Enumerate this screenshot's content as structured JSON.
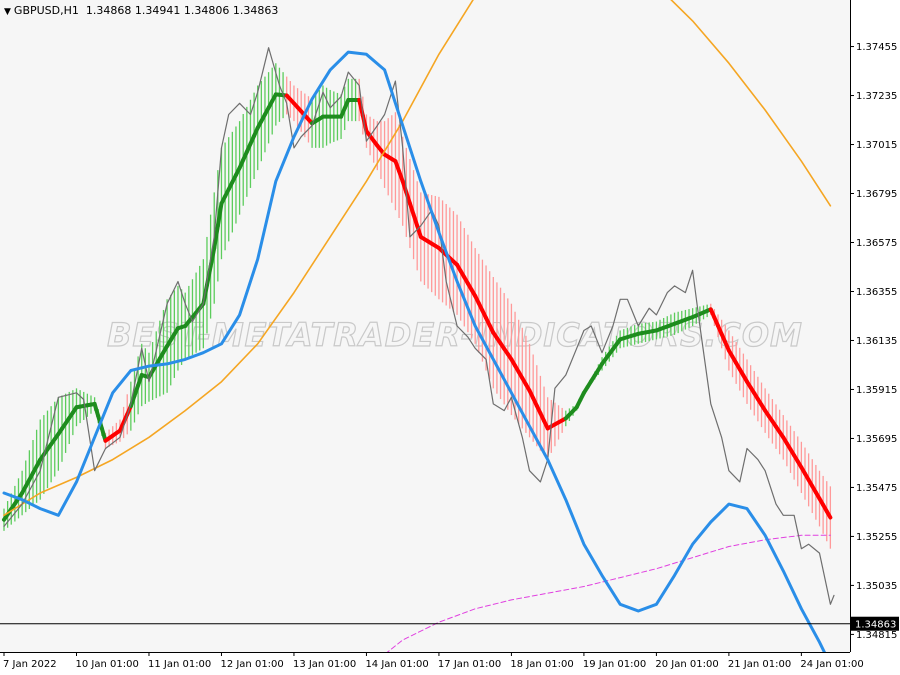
{
  "header": {
    "symbol": "GBPUSD,H1",
    "ohlc": "1.34868 1.34941 1.34806 1.34863",
    "arrow": "▼"
  },
  "watermark": "BEST-METATRADER-INDICATORS.COM",
  "colors": {
    "background": "#f6f6f6",
    "axis_background": "#ffffff",
    "bull": "#1e8c1e",
    "bull_light": "#5ccc5c",
    "bear": "#ff0000",
    "bear_light": "#ff9999",
    "fast_ma": "#2a8ee8",
    "slow_ma": "#f5a623",
    "long_ma": "#e040e0",
    "price_line": "#6e6e6e",
    "bid_line": "#000000"
  },
  "chart_data": {
    "type": "line",
    "ylim": [
      1.34736,
      1.37664
    ],
    "y_ticks": [
      "1.37455",
      "1.37235",
      "1.37015",
      "1.36795",
      "1.36575",
      "1.36355",
      "1.36135",
      "1.35915",
      "1.35695",
      "1.35475",
      "1.35255",
      "1.35035",
      "1.34815"
    ],
    "y_tick_values": [
      1.37455,
      1.37235,
      1.37015,
      1.36795,
      1.36575,
      1.36355,
      1.36135,
      1.35915,
      1.35695,
      1.35475,
      1.35255,
      1.35035,
      1.34815
    ],
    "x_ticks": [
      "7 Jan 2022",
      "10 Jan 01:00",
      "11 Jan 01:00",
      "12 Jan 01:00",
      "13 Jan 01:00",
      "14 Jan 01:00",
      "17 Jan 01:00",
      "18 Jan 01:00",
      "19 Jan 01:00",
      "20 Jan 01:00",
      "21 Jan 01:00",
      "24 Jan 01:00"
    ],
    "x_tick_index": [
      0,
      20,
      40,
      60,
      80,
      100,
      120,
      140,
      160,
      180,
      200,
      220
    ],
    "current_price": "1.34863",
    "current_price_value": 1.34863,
    "series": [
      {
        "role": "price",
        "x": [
          0,
          5,
          10,
          15,
          20,
          22,
          25,
          28,
          32,
          35,
          38,
          40,
          45,
          48,
          50,
          52,
          55,
          58,
          60,
          62,
          65,
          68,
          70,
          73,
          76,
          78,
          80,
          82,
          85,
          88,
          90,
          93,
          95,
          98,
          100,
          103,
          105,
          108,
          110,
          112,
          115,
          118,
          120,
          122,
          125,
          128,
          130,
          133,
          135,
          138,
          140,
          143,
          145,
          148,
          150,
          152,
          155,
          158,
          160,
          162,
          165,
          168,
          170,
          172,
          175,
          178,
          180,
          183,
          185,
          188,
          190,
          192,
          195,
          198,
          200,
          203,
          205,
          208,
          210,
          213,
          215,
          218,
          220,
          222,
          225,
          228,
          229
        ],
        "y": [
          1.353,
          1.354,
          1.3555,
          1.3588,
          1.359,
          1.3587,
          1.3555,
          1.3565,
          1.357,
          1.3585,
          1.361,
          1.3595,
          1.363,
          1.364,
          1.363,
          1.3622,
          1.363,
          1.366,
          1.37,
          1.3715,
          1.372,
          1.3715,
          1.3725,
          1.3745,
          1.3728,
          1.372,
          1.37,
          1.3705,
          1.371,
          1.3725,
          1.3718,
          1.3723,
          1.3734,
          1.3728,
          1.3703,
          1.371,
          1.3715,
          1.373,
          1.37,
          1.366,
          1.3665,
          1.3672,
          1.3665,
          1.364,
          1.362,
          1.3615,
          1.361,
          1.3605,
          1.3585,
          1.3582,
          1.3588,
          1.357,
          1.3555,
          1.355,
          1.356,
          1.3592,
          1.3598,
          1.361,
          1.3618,
          1.362,
          1.3608,
          1.362,
          1.3632,
          1.3632,
          1.362,
          1.3628,
          1.3625,
          1.3635,
          1.3638,
          1.3635,
          1.3645,
          1.362,
          1.3585,
          1.357,
          1.3555,
          1.355,
          1.3565,
          1.356,
          1.3555,
          1.354,
          1.3535,
          1.3535,
          1.352,
          1.3522,
          1.3518,
          1.3495,
          1.3499
        ]
      },
      {
        "role": "fast_ma",
        "x": [
          0,
          5,
          10,
          15,
          20,
          25,
          30,
          35,
          40,
          45,
          50,
          55,
          60,
          65,
          70,
          75,
          80,
          85,
          90,
          95,
          100,
          105,
          110,
          115,
          120,
          125,
          130,
          135,
          140,
          145,
          150,
          155,
          160,
          165,
          170,
          175,
          180,
          185,
          190,
          195,
          200,
          205,
          210,
          215,
          220,
          225,
          228
        ],
        "y": [
          1.3545,
          1.3542,
          1.3538,
          1.3535,
          1.355,
          1.357,
          1.359,
          1.36,
          1.3602,
          1.3603,
          1.3605,
          1.3608,
          1.3612,
          1.3625,
          1.365,
          1.3685,
          1.3705,
          1.3722,
          1.3735,
          1.3743,
          1.3742,
          1.3735,
          1.371,
          1.3685,
          1.3662,
          1.364,
          1.362,
          1.3605,
          1.359,
          1.3575,
          1.356,
          1.3542,
          1.3522,
          1.3508,
          1.3495,
          1.3492,
          1.3495,
          1.3508,
          1.3522,
          1.3532,
          1.354,
          1.3538,
          1.3526,
          1.351,
          1.3493,
          1.3478,
          1.3468
        ]
      },
      {
        "role": "slow_ma",
        "x": [
          0,
          10,
          20,
          30,
          40,
          50,
          60,
          70,
          80,
          90,
          100,
          110,
          120,
          130,
          140,
          150,
          160,
          170,
          180,
          190,
          200,
          210,
          220,
          228
        ],
        "y": [
          1.3535,
          1.3545,
          1.3552,
          1.356,
          1.357,
          1.3582,
          1.3595,
          1.3612,
          1.3635,
          1.366,
          1.3685,
          1.3712,
          1.3742,
          1.3768,
          1.3786,
          1.3795,
          1.3794,
          1.3786,
          1.3773,
          1.3757,
          1.3738,
          1.3717,
          1.3694,
          1.3674
        ]
      },
      {
        "role": "long_ma",
        "x": [
          100,
          110,
          120,
          130,
          140,
          150,
          160,
          170,
          180,
          190,
          200,
          210,
          220,
          228
        ],
        "y": [
          1.3466,
          1.3479,
          1.3487,
          1.3493,
          1.3497,
          1.35,
          1.3503,
          1.3507,
          1.3511,
          1.3516,
          1.3521,
          1.3524,
          1.3526,
          1.3526
        ]
      },
      {
        "role": "signal_band",
        "x": [
          0,
          5,
          10,
          15,
          20,
          25,
          28,
          32,
          35,
          38,
          40,
          45,
          48,
          50,
          55,
          58,
          60,
          65,
          70,
          75,
          78,
          80,
          85,
          88,
          90,
          93,
          95,
          98,
          100,
          103,
          105,
          108,
          110,
          115,
          120,
          125,
          130,
          135,
          140,
          145,
          150,
          155,
          158,
          160,
          165,
          170,
          175,
          180,
          185,
          190,
          195,
          200,
          205,
          210,
          215,
          220,
          225,
          228
        ],
        "high": [
          1.3538,
          1.3555,
          1.3578,
          1.3588,
          1.3592,
          1.3588,
          1.3572,
          1.3578,
          1.3595,
          1.3612,
          1.3608,
          1.3632,
          1.3638,
          1.3635,
          1.365,
          1.368,
          1.37,
          1.3712,
          1.3728,
          1.3738,
          1.3732,
          1.3728,
          1.3722,
          1.3728,
          1.3726,
          1.3724,
          1.3731,
          1.3731,
          1.3715,
          1.3712,
          1.3712,
          1.3716,
          1.3705,
          1.368,
          1.3678,
          1.367,
          1.3655,
          1.3642,
          1.363,
          1.3612,
          1.3588,
          1.3582,
          1.3585,
          1.359,
          1.3606,
          1.3618,
          1.3621,
          1.3622,
          1.3626,
          1.3628,
          1.363,
          1.3618,
          1.3605,
          1.3592,
          1.358,
          1.3568,
          1.3555,
          1.3548
        ],
        "low": [
          1.3528,
          1.3535,
          1.3542,
          1.3555,
          1.3575,
          1.3582,
          1.3565,
          1.3568,
          1.3573,
          1.3584,
          1.3586,
          1.359,
          1.36,
          1.3605,
          1.361,
          1.363,
          1.365,
          1.367,
          1.369,
          1.371,
          1.3715,
          1.3712,
          1.37,
          1.37,
          1.3702,
          1.3704,
          1.3712,
          1.3712,
          1.37,
          1.369,
          1.3682,
          1.3672,
          1.3665,
          1.364,
          1.3632,
          1.3625,
          1.3612,
          1.3592,
          1.358,
          1.357,
          1.356,
          1.3575,
          1.3582,
          1.359,
          1.36,
          1.361,
          1.3612,
          1.3614,
          1.3616,
          1.362,
          1.3625,
          1.36,
          1.3585,
          1.3572,
          1.356,
          1.3545,
          1.353,
          1.352
        ],
        "trend": [
          1,
          1,
          1,
          1,
          1,
          1,
          -1,
          -1,
          1,
          1,
          1,
          1,
          1,
          1,
          1,
          1,
          1,
          1,
          1,
          1,
          -1,
          -1,
          1,
          1,
          1,
          1,
          1,
          -1,
          -1,
          -1,
          -1,
          -1,
          -1,
          -1,
          -1,
          -1,
          -1,
          -1,
          -1,
          -1,
          -1,
          1,
          1,
          1,
          1,
          1,
          1,
          1,
          1,
          1,
          -1,
          -1,
          -1,
          -1,
          -1,
          -1,
          -1,
          -1
        ]
      }
    ]
  }
}
